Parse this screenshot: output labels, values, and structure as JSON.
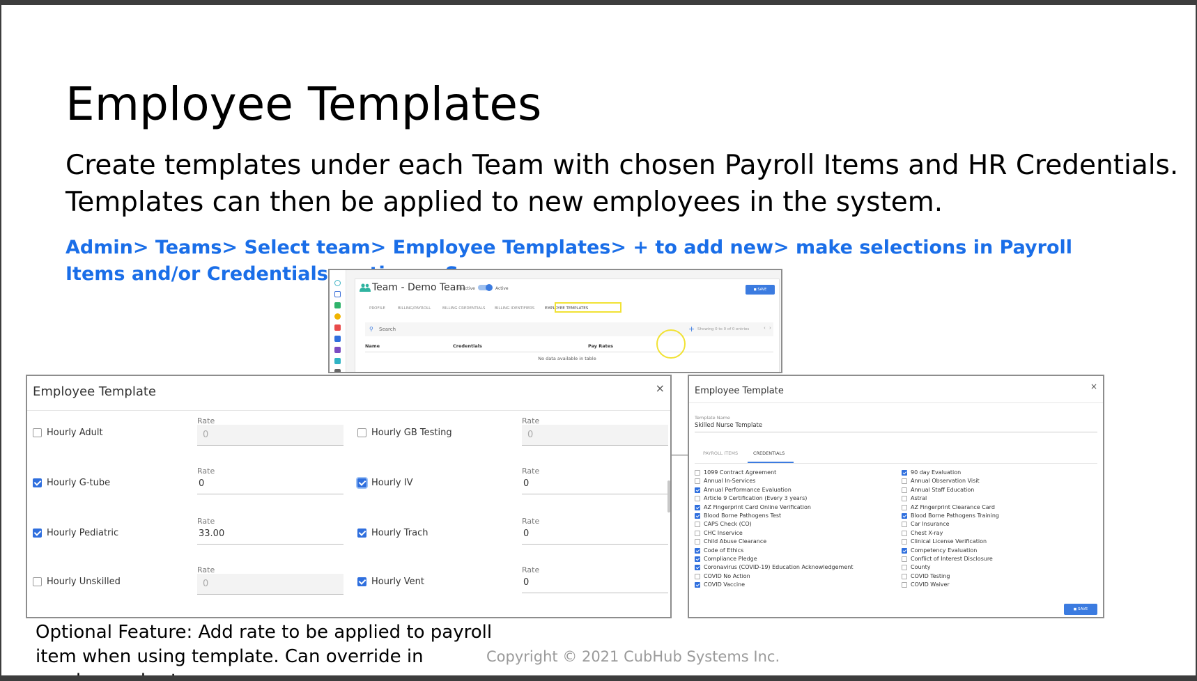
{
  "slide": {
    "title": "Employee Templates",
    "subtitle": "Create templates under each Team with chosen Payroll Items and HR Credentials. Templates can then be applied to new employees in the system.",
    "path": "Admin> Teams> Select team> Employee Templates> + to add new> make selections in Payroll Items and/or Credentials sections> Save",
    "note": "Optional Feature: Add rate to be applied to payroll item when using template. Can override in employee chart.",
    "copyright": "Copyright © 2021 CubHub Systems Inc."
  },
  "team_screen": {
    "title": "Team - Demo Team",
    "inactive_label": "Inactive",
    "active_label": "Active",
    "save_label": "SAVE",
    "tabs": [
      "PROFILE",
      "BILLING/PAYROLL",
      "BILLING CREDENTIALS",
      "BILLING IDENTIFIERS",
      "EMPLOYEE TEMPLATES"
    ],
    "search_placeholder": "Search",
    "add_symbol": "+",
    "showing": "Showing 0 to 0 of 0 entries",
    "pager_prev": "‹",
    "pager_next": "›",
    "columns": [
      "Name",
      "Credentials",
      "Pay Rates"
    ],
    "empty": "No data available in table",
    "highlight_color": "#f1e234"
  },
  "payroll_modal": {
    "title": "Employee Template",
    "close": "×",
    "rate_label": "Rate",
    "items": [
      {
        "label": "Hourly Adult",
        "checked": false,
        "rate": "0",
        "disabled": true
      },
      {
        "label": "Hourly GB Testing",
        "checked": false,
        "rate": "0",
        "disabled": true
      },
      {
        "label": "Hourly G-tube",
        "checked": true,
        "rate": "0",
        "disabled": false
      },
      {
        "label": "Hourly IV",
        "checked": true,
        "rate": "0",
        "disabled": false
      },
      {
        "label": "Hourly Pediatric",
        "checked": true,
        "rate": "33.00",
        "disabled": false
      },
      {
        "label": "Hourly Trach",
        "checked": true,
        "rate": "0",
        "disabled": false
      },
      {
        "label": "Hourly Unskilled",
        "checked": false,
        "rate": "0",
        "disabled": true
      },
      {
        "label": "Hourly Vent",
        "checked": true,
        "rate": "0",
        "disabled": false
      }
    ]
  },
  "cred_modal": {
    "title": "Employee Template",
    "close": "×",
    "name_label": "Template Name",
    "name_value": "Skilled Nurse Template",
    "tab_payroll": "PAYROLL ITEMS",
    "tab_credentials": "CREDENTIALS",
    "save_label": "SAVE",
    "left_col": [
      {
        "label": "1099 Contract Agreement",
        "checked": false
      },
      {
        "label": "Annual In-Services",
        "checked": false
      },
      {
        "label": "Annual Performance Evaluation",
        "checked": true
      },
      {
        "label": "Article 9 Certification (Every 3 years)",
        "checked": false
      },
      {
        "label": "AZ Fingerprint Card Online Verification",
        "checked": true
      },
      {
        "label": "Blood Borne Pathogens Test",
        "checked": true
      },
      {
        "label": "CAPS Check (CO)",
        "checked": false
      },
      {
        "label": "CHC Inservice",
        "checked": false
      },
      {
        "label": "Child Abuse Clearance",
        "checked": false
      },
      {
        "label": "Code of Ethics",
        "checked": true
      },
      {
        "label": "Compliance Pledge",
        "checked": true
      },
      {
        "label": "Coronavirus (COVID-19) Education Acknowledgement",
        "checked": true
      },
      {
        "label": "COVID No Action",
        "checked": false
      },
      {
        "label": "COVID Vaccine",
        "checked": true
      }
    ],
    "right_col": [
      {
        "label": "90 day Evaluation",
        "checked": true
      },
      {
        "label": "Annual Observation Visit",
        "checked": false
      },
      {
        "label": "Annual Staff Education",
        "checked": false
      },
      {
        "label": "Astral",
        "checked": false
      },
      {
        "label": "AZ Fingerprint Clearance Card",
        "checked": false
      },
      {
        "label": "Blood Borne Pathogens Training",
        "checked": true
      },
      {
        "label": "Car Insurance",
        "checked": false
      },
      {
        "label": "Chest X-ray",
        "checked": false
      },
      {
        "label": "Clinical License Verification",
        "checked": false
      },
      {
        "label": "Competency Evaluation",
        "checked": true
      },
      {
        "label": "Conflict of Interest Disclosure",
        "checked": false
      },
      {
        "label": "County",
        "checked": false
      },
      {
        "label": "COVID Testing",
        "checked": false
      },
      {
        "label": "COVID Waiver",
        "checked": false
      }
    ]
  },
  "colors": {
    "accent": "#1a6ee8",
    "button": "#3b7be0",
    "checkbox": "#2f6fde"
  }
}
